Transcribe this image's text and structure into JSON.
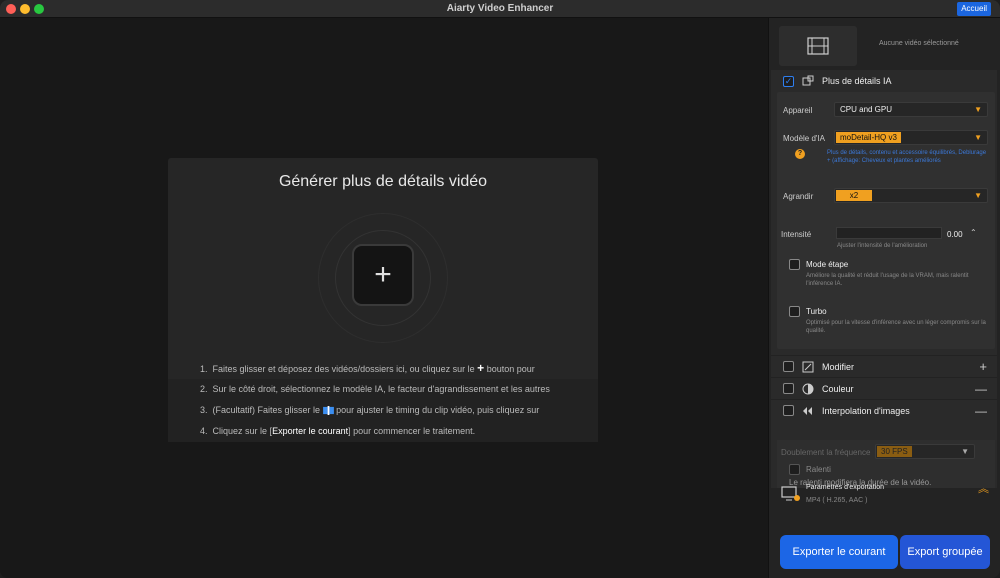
{
  "window": {
    "title": "Aiarty Video Enhancer",
    "home_button": "Accueil"
  },
  "main": {
    "drop_title": "Générer plus de détails vidéo",
    "steps": [
      {
        "num": "1.",
        "pre": "Faites glisser et déposez des vidéos/dossiers ici, ou cliquez sur le",
        "post": "bouton pour"
      },
      {
        "num": "2.",
        "text": "Sur le côté droit, sélectionnez le modèle IA, le facteur d'agrandissement et les autres"
      },
      {
        "num": "3.",
        "pre": "(Facultatif) Faites glisser le",
        "post": "pour ajuster le timing du clip vidéo, puis cliquez sur"
      },
      {
        "num": "4.",
        "pre": "Cliquez sur le [",
        "bold": "Exporter le courant",
        "post": "] pour commencer le traitement."
      }
    ]
  },
  "panel": {
    "no_video": "Aucune vidéo sélectionné",
    "details": {
      "label": "Plus de détails IA",
      "appareil_label": "Appareil",
      "appareil_value": "CPU and GPU",
      "modele_label": "Modèle d'IA",
      "modele_value": "moDetail-HQ  v3",
      "modele_hint": "Plus de détails, contenu et accessoire équilibrés, Deblurage + (affichage: Cheveux et plantes améliorés",
      "agrandir_label": "Agrandir",
      "agrandir_value": "x2",
      "intensite_label": "Intensité",
      "intensite_value": "0.00",
      "intensite_hint": "Ajuster l'intensité de l'amélioration",
      "mode_etape_label": "Mode étape",
      "mode_etape_hint": "Améliore la qualité et réduit l'usage de la VRAM, mais ralentit l'inférence IA.",
      "turbo_label": "Turbo",
      "turbo_hint": "Optimisé pour la vitesse d'inférence avec un léger compromis sur la qualité."
    },
    "modifier_label": "Modifier",
    "couleur_label": "Couleur",
    "interpolation_label": "Interpolation d'images",
    "interpolation": {
      "rate_label": "Doublement la fréquence",
      "rate_value": "30 FPS",
      "ralenti_label": "Ralenti",
      "ralenti_hint": "Le ralenti modifiera la durée de la vidéo."
    },
    "export_params": {
      "title": "Paramètres d'exportation",
      "subtitle": "MP4 ( H.265, AAC )"
    },
    "export_current": "Exporter le courant",
    "export_batch": "Export groupée"
  },
  "colors": {
    "accent": "#1c66e6",
    "orange": "#f0a020"
  }
}
